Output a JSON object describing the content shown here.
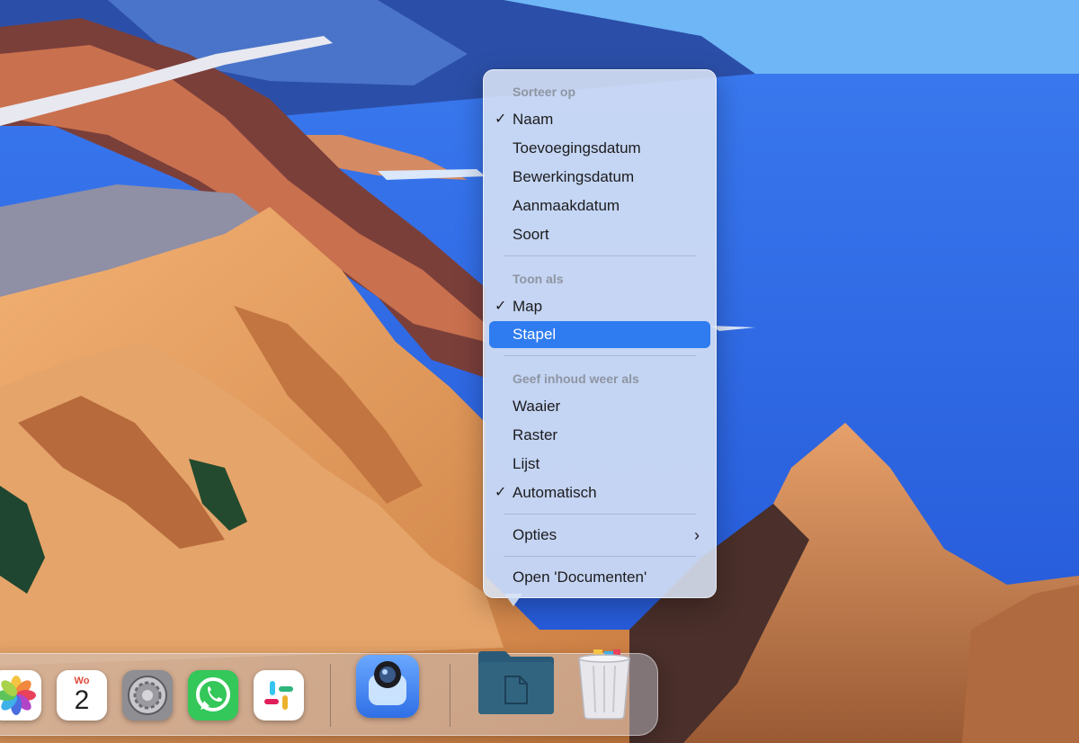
{
  "menu": {
    "sort_header": "Sorteer op",
    "sort_items": [
      "Naam",
      "Toevoegingsdatum",
      "Bewerkingsdatum",
      "Aanmaakdatum",
      "Soort"
    ],
    "view_header": "Toon als",
    "view_items": [
      "Map",
      "Stapel"
    ],
    "content_header": "Geef inhoud weer als",
    "content_items": [
      "Waaier",
      "Raster",
      "Lijst",
      "Automatisch"
    ],
    "options": "Opties",
    "open": "Open 'Documenten'"
  },
  "dock": {
    "calendar_day": "Wo",
    "calendar_date": "2"
  },
  "colors": {
    "selection": "#2e7cf0",
    "sea": "#2f6fe6",
    "sky": "#6fb6f6"
  },
  "icons": [
    "checkmark-icon",
    "chevron-right-icon",
    "photos-icon",
    "calendar-icon",
    "system-preferences-icon",
    "whatsapp-icon",
    "slack-icon",
    "preview-icon",
    "documents-folder-icon",
    "trash-icon"
  ]
}
